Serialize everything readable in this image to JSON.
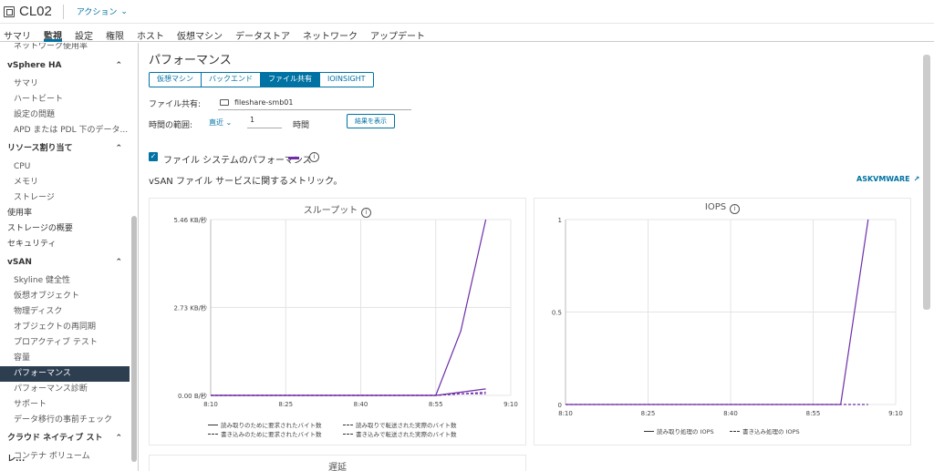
{
  "header": {
    "title": "CL02",
    "actions_label": "アクション"
  },
  "tabs": [
    "サマリ",
    "監視",
    "設定",
    "権限",
    "ホスト",
    "仮想マシン",
    "データストア",
    "ネットワーク",
    "アップデート"
  ],
  "active_tab": 1,
  "sidebar": {
    "partial_top": "ネットワーク使用率",
    "vsphere_ha": {
      "label": "vSphere HA",
      "items": [
        "サマリ",
        "ハートビート",
        "設定の問題",
        "APD または PDL 下のデータ..."
      ]
    },
    "resources": {
      "label": "リソース割り当て",
      "items": [
        "CPU",
        "メモリ",
        "ストレージ"
      ]
    },
    "top_items": [
      "使用率",
      "ストレージの概要",
      "セキュリティ"
    ],
    "vsan": {
      "label": "vSAN",
      "items": [
        "Skyline 健全性",
        "仮想オブジェクト",
        "物理ディスク",
        "オブジェクトの再同期",
        "プロアクティブ テスト",
        "容量",
        "パフォーマンス",
        "パフォーマンス診断",
        "サポート",
        "データ移行の事前チェック"
      ],
      "active_index": 6
    },
    "cloud_native": {
      "label": "クラウド ネイティブ ストレ...",
      "items": [
        "コンテナ ボリューム"
      ]
    }
  },
  "main": {
    "title": "パフォーマンス",
    "segments": [
      "仮想マシン",
      "バックエンド",
      "ファイル共有",
      "IOINSIGHT"
    ],
    "active_segment": 2,
    "file_share_label": "ファイル共有:",
    "file_share_value": "fileshare-smb01",
    "period_label": "時間の範囲:",
    "period_value": "直近",
    "period_number": "1",
    "period_unit": "時間",
    "show_button": "結果を表示",
    "fs_checkbox_label": "ファイル システムのパフォーマンス",
    "description": "vSAN ファイル サービスに関するメトリック。",
    "ask_link": "ASKVMWARE",
    "bottom_panel_title": "遅延"
  },
  "colors": {
    "accent": "#0072a3",
    "series_purple": "#6f2da8",
    "sidebar_active": "#2c3e50"
  },
  "chart_data": [
    {
      "type": "line",
      "title": "スループット",
      "x": [
        "8:10",
        "8:25",
        "8:40",
        "8:55",
        "9:10"
      ],
      "ylabel": "",
      "y_ticks": [
        "0.00 B/秒",
        "2.73 KB/秒",
        "5.46 KB/秒"
      ],
      "ylim": [
        0,
        5.46
      ],
      "series": [
        {
          "name": "読み取りのために要求されたバイト数",
          "style": "solid",
          "points": [
            [
              "8:10",
              0
            ],
            [
              "8:55",
              0
            ],
            [
              "9:00",
              2.0
            ],
            [
              "9:05",
              5.46
            ]
          ]
        },
        {
          "name": "読み取りで転送された実際のバイト数",
          "style": "dashed",
          "points": [
            [
              "8:10",
              0
            ],
            [
              "8:55",
              0
            ],
            [
              "9:00",
              0.05
            ],
            [
              "9:05",
              0.05
            ]
          ]
        },
        {
          "name": "書き込みのために要求されたバイト数",
          "style": "solid",
          "points": [
            [
              "8:10",
              0
            ],
            [
              "8:55",
              0
            ],
            [
              "9:00",
              0.1
            ],
            [
              "9:05",
              0.2
            ]
          ]
        },
        {
          "name": "書き込みで転送された実際のバイト数",
          "style": "dashed",
          "points": [
            [
              "8:10",
              0
            ],
            [
              "8:55",
              0
            ],
            [
              "9:00",
              0.05
            ],
            [
              "9:05",
              0.1
            ]
          ]
        }
      ],
      "grid": true,
      "legend": "bottom"
    },
    {
      "type": "line",
      "title": "IOPS",
      "x": [
        "8:10",
        "8:25",
        "8:40",
        "8:55",
        "9:10"
      ],
      "y_ticks": [
        "0",
        "0.5",
        "1"
      ],
      "ylim": [
        0,
        1
      ],
      "series": [
        {
          "name": "読み取り処理の IOPS",
          "style": "solid",
          "points": [
            [
              "8:10",
              0
            ],
            [
              "9:00",
              0
            ],
            [
              "9:05",
              1
            ]
          ]
        },
        {
          "name": "書き込み処理の IOPS",
          "style": "dashed",
          "points": [
            [
              "8:10",
              0
            ],
            [
              "9:00",
              0
            ],
            [
              "9:05",
              0
            ]
          ]
        }
      ],
      "grid": true,
      "legend": "bottom"
    }
  ]
}
